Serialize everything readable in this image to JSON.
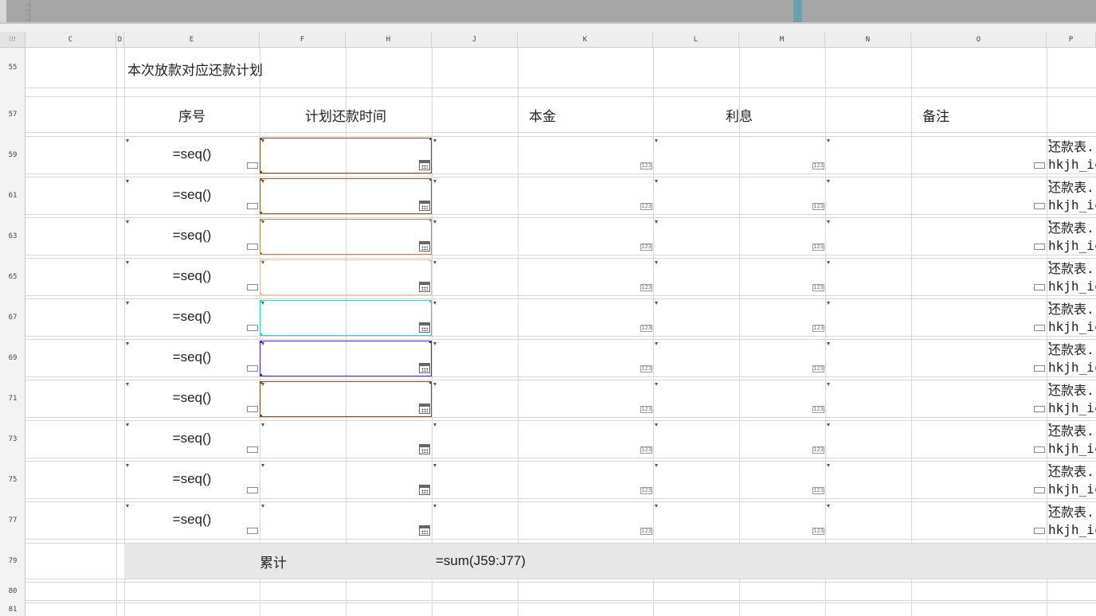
{
  "columns": [
    "C",
    "D",
    "E",
    "F",
    "H",
    "J",
    "K",
    "L",
    "M",
    "N",
    "O",
    "P"
  ],
  "row_numbers": [
    "55",
    "57",
    "59",
    "61",
    "63",
    "65",
    "67",
    "69",
    "71",
    "73",
    "75",
    "77",
    "79",
    "80",
    "81"
  ],
  "sheet": {
    "title": "本次放款对应还款计划",
    "headers": {
      "seq": "序号",
      "plan_date": "计划还款时间",
      "principal": "本金",
      "interest": "利息",
      "remark": "备注"
    },
    "rows": [
      {
        "seq": "=seq()",
        "p_line1": "还款表.",
        "p_line2": "hkjh_ic",
        "box_color": "#7b4a22"
      },
      {
        "seq": "=seq()",
        "p_line1": "还款表.",
        "p_line2": "hkjh_ic",
        "box_color": "#8a5a30"
      },
      {
        "seq": "=seq()",
        "p_line1": "还款表.",
        "p_line2": "hkjh_ic",
        "box_color": "#b98a55"
      },
      {
        "seq": "=seq()",
        "p_line1": "还款表.",
        "p_line2": "hkjh_ic",
        "box_color": "#e6c29a"
      },
      {
        "seq": "=seq()",
        "p_line1": "还款表.",
        "p_line2": "hkjh_ic",
        "box_color": "#2fd3c4"
      },
      {
        "seq": "=seq()",
        "p_line1": "还款表.",
        "p_line2": "hkjh_ic",
        "box_color": "#4b1fd6"
      },
      {
        "seq": "=seq()",
        "p_line1": "还款表.",
        "p_line2": "hkjh_ic",
        "box_color": "#7b4a22"
      },
      {
        "seq": "=seq()",
        "p_line1": "还款表.",
        "p_line2": "hkjh_ic",
        "box_color": ""
      },
      {
        "seq": "=seq()",
        "p_line1": "还款表.",
        "p_line2": "hkjh_ic",
        "box_color": ""
      },
      {
        "seq": "=seq()",
        "p_line1": "还款表.",
        "p_line2": "hkjh_ic",
        "box_color": ""
      }
    ],
    "total_label": "累计",
    "total_formula": "=sum(J59:J77)",
    "number_icon_text": "123"
  },
  "icons": {
    "calendar": "calendar-icon",
    "number": "number-format-icon",
    "expand": "expand-indicator-icon",
    "corner": "select-all-icon"
  }
}
